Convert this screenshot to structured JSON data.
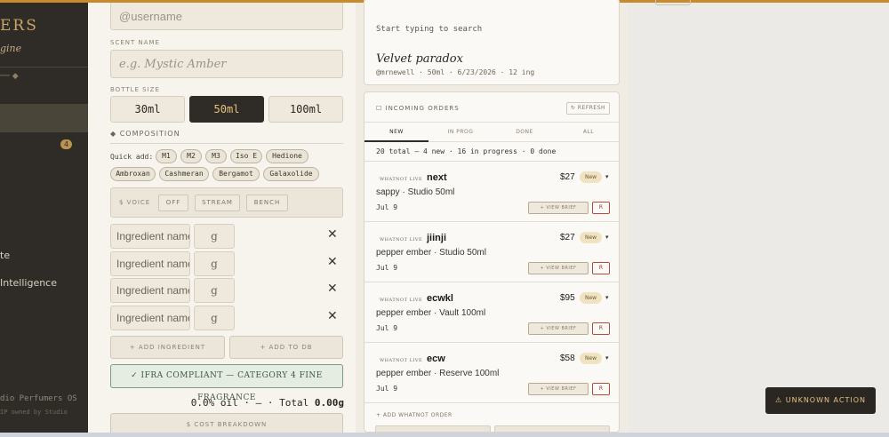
{
  "sidebar": {
    "brand": "ERS",
    "subtitle": "gine",
    "dash": "── ◆",
    "badge": "4",
    "items": [
      "te",
      "Intelligence"
    ],
    "footer_line1": "dio Perfumers OS",
    "footer_line2": "IP owned by Studio"
  },
  "form": {
    "username_placeholder": "@username",
    "scent_name_label": "SCENT NAME",
    "scent_name_placeholder": "e.g. Mystic Amber",
    "bottle_size_label": "BOTTLE SIZE",
    "sizes": [
      "30ml",
      "50ml",
      "100ml"
    ],
    "selected_size": "50ml",
    "composition_label": "◆ COMPOSITION",
    "quick_add_label": "Quick add:",
    "quick_add": [
      "M1",
      "M2",
      "M3",
      "Iso E",
      "Hedione",
      "Ambroxan",
      "Cashmeran",
      "Bergamot",
      "Galaxolide"
    ],
    "voice_label": "$ VOICE",
    "voice_options": [
      "OFF",
      "STREAM",
      "BENCH"
    ],
    "ingredient_placeholder": "Ingredient name",
    "grams_placeholder": "g",
    "remove_glyph": "✕",
    "add_ingredient": "+ ADD INGREDIENT",
    "add_to_db": "+ ADD TO DB",
    "ifra": "✓ IFRA COMPLIANT — CATEGORY 4 FINE FRAGRANCE",
    "total_prefix": "0.0% oil · — · Total ",
    "total_value": "0.00g",
    "cost_breakdown": "$ COST BREAKDOWN"
  },
  "search": {
    "hint": "Start typing to search",
    "recent_title": "Velvet paradox",
    "recent_meta": "@mrnewell · 50ml · 6/23/2026 · 12 ing"
  },
  "orders": {
    "header": "☐ INCOMING ORDERS",
    "refresh": "↻ REFRESH",
    "tabs": [
      "NEW",
      "IN PROG",
      "DONE",
      "ALL"
    ],
    "active_tab": "NEW",
    "summary": "20 total — 4 new · 16 in progress · 0 done",
    "list": [
      {
        "source": "WHATNOT LIVE",
        "user": "next",
        "price": "$27",
        "status": "New",
        "desc": "sappy · Studio 50ml",
        "date": "Jul 9"
      },
      {
        "source": "WHATNOT LIVE",
        "user": "jiinji",
        "price": "$27",
        "status": "New",
        "desc": "pepper ember · Studio 50ml",
        "date": "Jul 9"
      },
      {
        "source": "WHATNOT LIVE",
        "user": "ecwkl",
        "price": "$95",
        "status": "New",
        "desc": "pepper ember · Vault 100ml",
        "date": "Jul 9"
      },
      {
        "source": "WHATNOT LIVE",
        "user": "ecw",
        "price": "$58",
        "status": "New",
        "desc": "pepper ember · Reserve 100ml",
        "date": "Jul 9"
      }
    ],
    "view_brief": "+ VIEW BRIEF",
    "r_button": "R",
    "caret": "▾",
    "add_order": "+ ADD WHATNOT ORDER"
  },
  "toast": {
    "label": "⚠ UNKNOWN ACTION"
  },
  "colors": {
    "accent": "#c78a2c",
    "dark": "#2f2c28",
    "gold": "#e6c27f",
    "compliant": "#3d5a45",
    "danger": "#b84a3c"
  }
}
